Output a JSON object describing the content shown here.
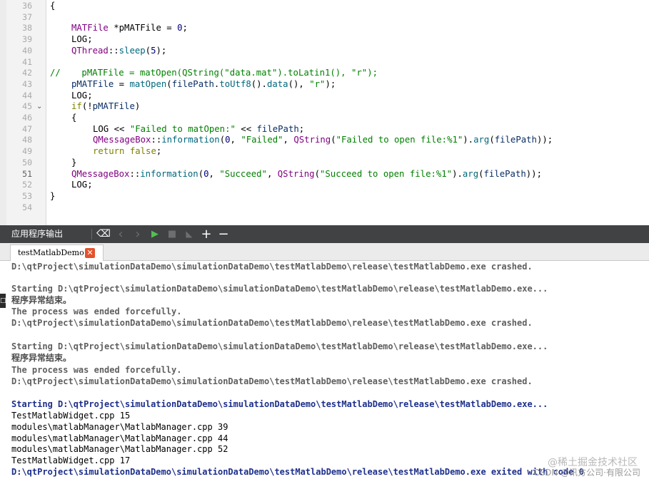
{
  "editor": {
    "line_numbers": [
      "36",
      "37",
      "38",
      "39",
      "40",
      "41",
      "42",
      "43",
      "44",
      "45",
      "46",
      "47",
      "48",
      "49",
      "50",
      "51",
      "52",
      "53",
      "54"
    ],
    "fold_marker": "⌄",
    "lines": {
      "l36": {
        "brace": "{"
      },
      "l38": {
        "type": "MATFile",
        "rest": " *pMATFile = ",
        "num": "0",
        "end": ";"
      },
      "l39": {
        "text": "LOG;"
      },
      "l40": {
        "cls": "QThread",
        "sep": "::",
        "fn": "sleep",
        "open": "(",
        "num": "5",
        "close": ");"
      },
      "l42": {
        "comment": "//    pMATFile = matOpen(QString(\"data.mat\").toLatin1(), \"r\");"
      },
      "l43": {
        "var": "pMATFile",
        "eq": " = ",
        "fn": "matOpen",
        "args1": "(",
        "arg": "filePath",
        "dot": ".",
        "m1": "toUtf8",
        "p1": "().",
        "m2": "data",
        "p2": "(), ",
        "str": "\"r\"",
        "end": ");"
      },
      "l44": {
        "text": "LOG;"
      },
      "l45": {
        "kw": "if",
        "rest": "(!",
        "var": "pMATFile",
        "end": ")"
      },
      "l46": {
        "brace": "{"
      },
      "l47": {
        "pre": "LOG << ",
        "str": "\"Failed to matOpen:\"",
        "mid": " << ",
        "var": "filePath",
        "end": ";"
      },
      "l48": {
        "cls": "QMessageBox",
        "sep": "::",
        "fn": "information",
        "a": "(",
        "num": "0",
        "b": ", ",
        "str1": "\"Failed\"",
        "c": ", ",
        "cls2": "QString",
        "d": "(",
        "str2": "\"Failed to open file:%1\"",
        "e": ").",
        "fn2": "arg",
        "f": "(",
        "var": "filePath",
        "g": "));"
      },
      "l49": {
        "kw": "return",
        "sp": " ",
        "kw2": "false",
        "end": ";"
      },
      "l50": {
        "brace": "}"
      },
      "l51": {
        "cls": "QMessageBox",
        "sep": "::",
        "fn": "information",
        "a": "(",
        "num": "0",
        "b": ", ",
        "str1": "\"Succeed\"",
        "c": ", ",
        "cls2": "QString",
        "d": "(",
        "str2": "\"Succeed to open file:%1\"",
        "e": ").",
        "fn2": "arg",
        "f": "(",
        "var": "filePath",
        "g": "));"
      },
      "l52": {
        "text": "LOG;"
      },
      "l53": {
        "brace": "}"
      }
    }
  },
  "output_pane": {
    "title": "应用程序输出",
    "toolbar_icons": {
      "clear": "⌫",
      "prev": "‹",
      "next": "›",
      "run": "▶",
      "stop": "■",
      "attach": "◣",
      "zoom_in": "+",
      "zoom_out": "−"
    }
  },
  "tab": {
    "label": "testMatlabDemo",
    "close": "✕"
  },
  "output": {
    "lines": [
      "D:\\qtProject\\simulationDataDemo\\simulationDataDemo\\testMatlabDemo\\release\\testMatlabDemo.exe crashed.",
      "",
      "Starting D:\\qtProject\\simulationDataDemo\\simulationDataDemo\\testMatlabDemo\\release\\testMatlabDemo.exe...",
      "程序异常结束。",
      "The process was ended forcefully.",
      "D:\\qtProject\\simulationDataDemo\\simulationDataDemo\\testMatlabDemo\\release\\testMatlabDemo.exe crashed.",
      "",
      "Starting D:\\qtProject\\simulationDataDemo\\simulationDataDemo\\testMatlabDemo\\release\\testMatlabDemo.exe...",
      "程序异常结束。",
      "The process was ended forcefully.",
      "D:\\qtProject\\simulationDataDemo\\simulationDataDemo\\testMatlabDemo\\release\\testMatlabDemo.exe crashed.",
      "",
      "Starting D:\\qtProject\\simulationDataDemo\\simulationDataDemo\\testMatlabDemo\\release\\testMatlabDemo.exe...",
      "TestMatlabWidget.cpp 15",
      "modules\\matlabManager\\MatlabManager.cpp 39",
      "modules\\matlabManager\\MatlabManager.cpp 44",
      "modules\\matlabManager\\MatlabManager.cpp 52",
      "TestMatlabWidget.cpp 17",
      "D:\\qtProject\\simulationDataDemo\\simulationDataDemo\\testMatlabDemo\\release\\testMatlabDemo.exe exited with code 0"
    ]
  },
  "left_edge_glyph": "□",
  "watermark": {
    "line1": "@稀土掘金技术社区",
    "line2": "CSDN @讯方公司·有限公司"
  }
}
